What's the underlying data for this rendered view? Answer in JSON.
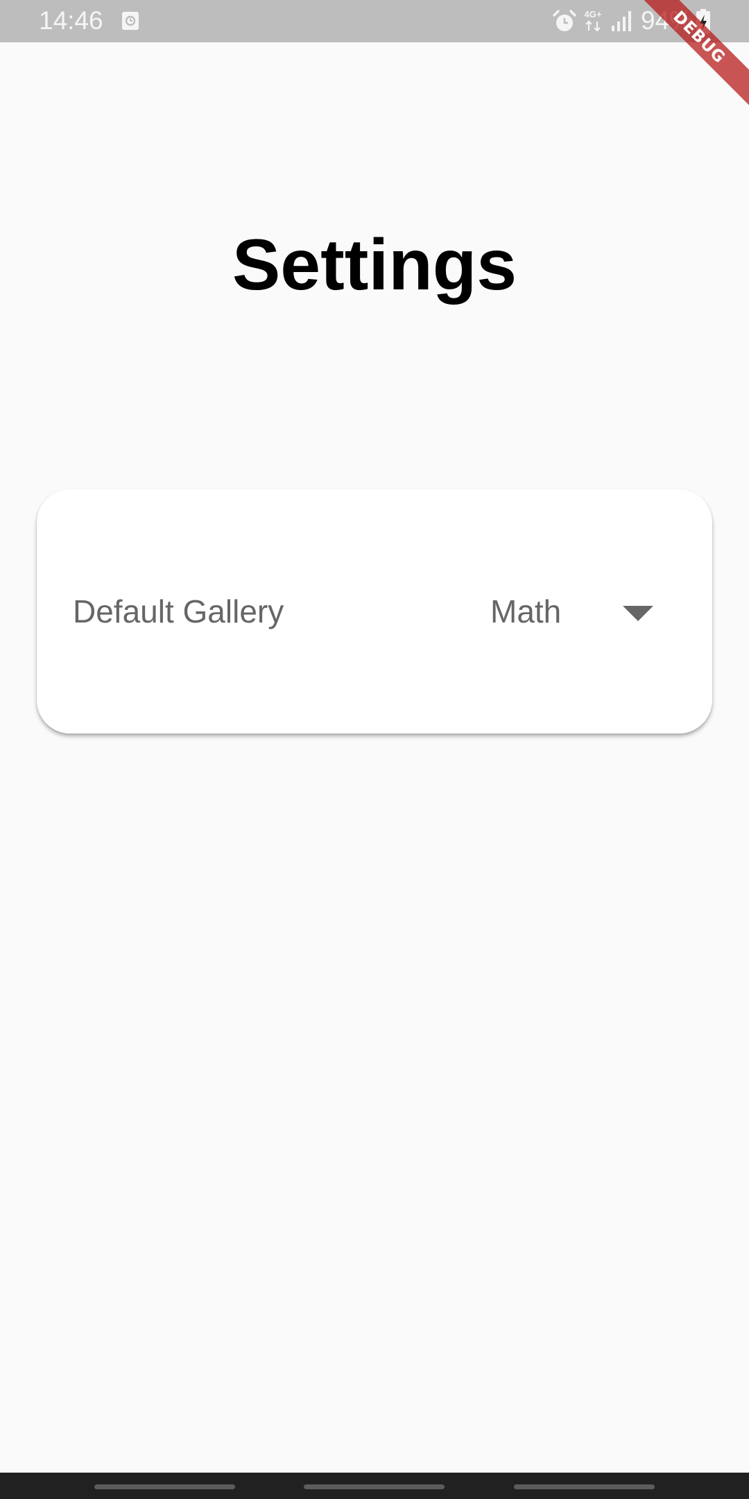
{
  "status_bar": {
    "time": "14:46",
    "battery_percent": "94%",
    "network_type": "4G+",
    "notification_icon": "screen-recorder-icon",
    "icons": [
      "alarm-icon",
      "network-type-icon",
      "signal-icon",
      "battery-charging-icon"
    ]
  },
  "debug_banner": {
    "label": "DEBUG"
  },
  "page": {
    "title": "Settings"
  },
  "settings": {
    "default_gallery": {
      "label": "Default Gallery",
      "selected_value": "Math"
    }
  },
  "colors": {
    "status_bar_bg": "#bdbdbd",
    "page_bg": "#fafafa",
    "card_bg": "#ffffff",
    "secondary_text": "#666666",
    "debug_ribbon": "#b71c1c",
    "nav_bar_bg": "#212121"
  }
}
